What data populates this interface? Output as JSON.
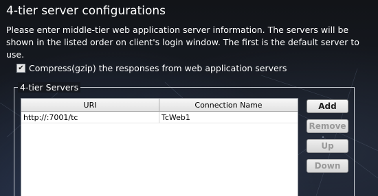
{
  "title": "4-tier server configurations",
  "description": "Please enter middle-tier web application server information. The servers will be shown in the listed order on client's login window. The first is the default server to use.",
  "compress": {
    "label": "Compress(gzip) the responses from web application servers",
    "checked": true
  },
  "servers_group": {
    "label": "4-tier Servers",
    "columns": [
      "URI",
      "Connection Name"
    ],
    "rows": [
      {
        "uri": "http://:7001/tc",
        "connection_name": "TcWeb1"
      }
    ]
  },
  "buttons": {
    "add": "Add",
    "remove": "Remove",
    "up": "Up",
    "down": "Down"
  }
}
